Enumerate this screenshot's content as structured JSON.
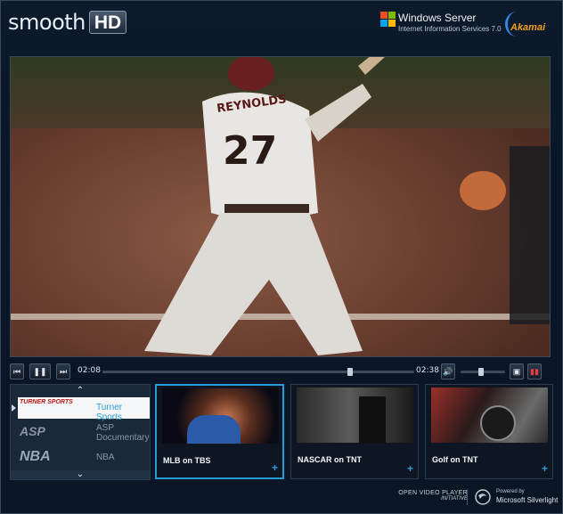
{
  "header": {
    "logo_word": "smooth",
    "logo_badge": "HD",
    "windows_server_title": "Windows Server",
    "windows_server_subtitle": "Internet Information Services 7.0",
    "akamai": "Akamai"
  },
  "video": {
    "player_jersey_name": "REYNOLDS",
    "player_number": "27"
  },
  "controls": {
    "elapsed": "02:08",
    "duration": "02:38",
    "progress": 0.8,
    "volume": 0.45
  },
  "playlist": {
    "items": [
      {
        "logo": "TURNER SPORTS",
        "label": "Turner Sports",
        "selected": true
      },
      {
        "logo": "ASP",
        "label": "ASP Documentary",
        "selected": false
      },
      {
        "logo": "NBA",
        "label": "NBA",
        "selected": false
      }
    ]
  },
  "cards": [
    {
      "title": "MLB on TBS",
      "selected": true
    },
    {
      "title": "NASCAR on TNT",
      "selected": false
    },
    {
      "title": "Golf on TNT",
      "selected": false
    }
  ],
  "footer": {
    "ovp_line1": "OPEN VIDEO PLAYER",
    "ovp_line2": "INITIATIVE",
    "powered_by": "Powered by",
    "silverlight": "Microsoft Silverlight"
  },
  "colors": {
    "accent": "#2a9bd6",
    "background": "#0a1320",
    "akamai": "#f0a020"
  }
}
